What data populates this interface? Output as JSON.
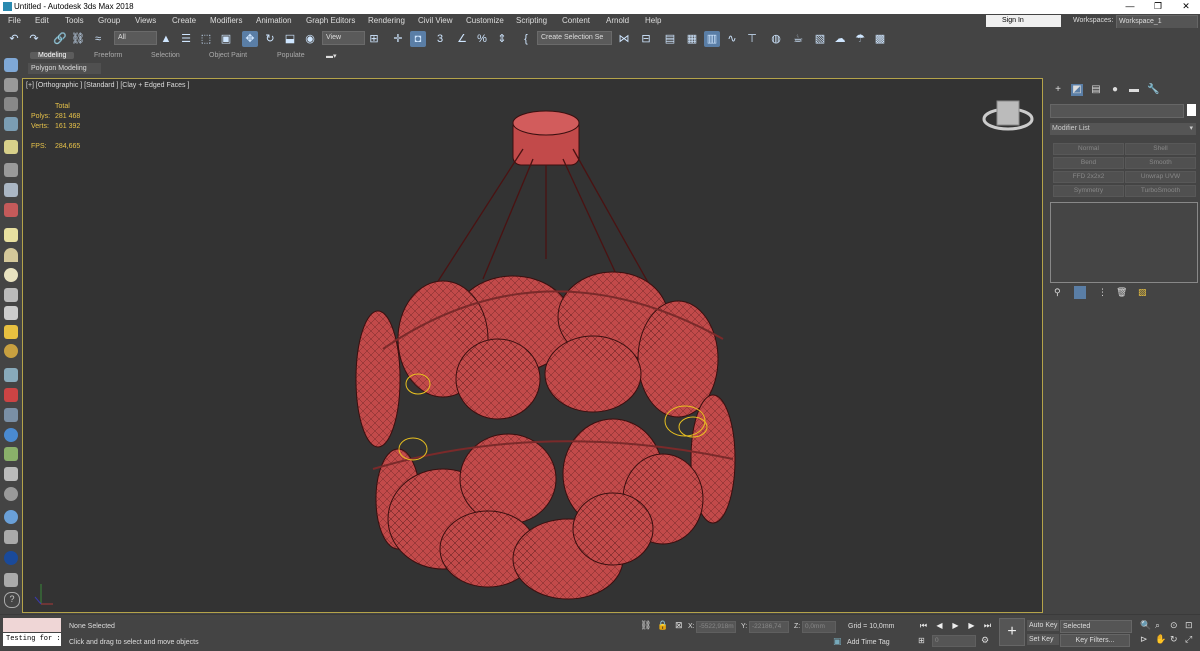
{
  "window": {
    "title": "Untitled - Autodesk 3ds Max 2018",
    "minimize": "—",
    "maximize": "❐",
    "close": "✕"
  },
  "menu": [
    "File",
    "Edit",
    "Tools",
    "Group",
    "Views",
    "Create",
    "Modifiers",
    "Animation",
    "Graph Editors",
    "Rendering",
    "Civil View",
    "Customize",
    "Scripting",
    "Content",
    "Arnold",
    "Help"
  ],
  "account": {
    "signin": "Sign In",
    "workspaces_label": "Workspaces:",
    "workspace": "Workspace_1"
  },
  "toolbar": {
    "selection_filter": "All",
    "ref_coord": "View",
    "named_selection": "Create Selection Se"
  },
  "ribbon": {
    "tabs": [
      "Modeling",
      "Freeform",
      "Selection",
      "Object Paint",
      "Populate"
    ],
    "active": "Modeling",
    "sub": "Polygon Modeling"
  },
  "viewport": {
    "label": "[+] [Orthographic ] [Standard ] [Clay + Edged Faces ]",
    "stats": {
      "total_label": "Total",
      "polys_label": "Polys:",
      "polys": "281 468",
      "verts_label": "Verts:",
      "verts": "161 392",
      "fps_label": "FPS:",
      "fps": "284,665"
    }
  },
  "command_panel": {
    "modifier_list": "Modifier List",
    "buttons": [
      "Normal",
      "Shell",
      "Bend",
      "Smooth",
      "FFD 2x2x2",
      "Unwrap UVW",
      "Symmetry",
      "TurboSmooth"
    ]
  },
  "status": {
    "script_text": "Testing for :",
    "selection": "None Selected",
    "prompt": "Click and drag to select and move objects",
    "x_label": "X:",
    "x": "-5522,918m",
    "y_label": "Y:",
    "y": "-22186,74",
    "z_label": "Z:",
    "z": "0,0mm",
    "grid": "Grid = 10,0mm",
    "add_time_tag": "Add Time Tag",
    "auto_key": "Auto Key",
    "set_key": "Set Key",
    "key_mode": "Selected",
    "key_filters": "Key Filters...",
    "frame": "0"
  }
}
